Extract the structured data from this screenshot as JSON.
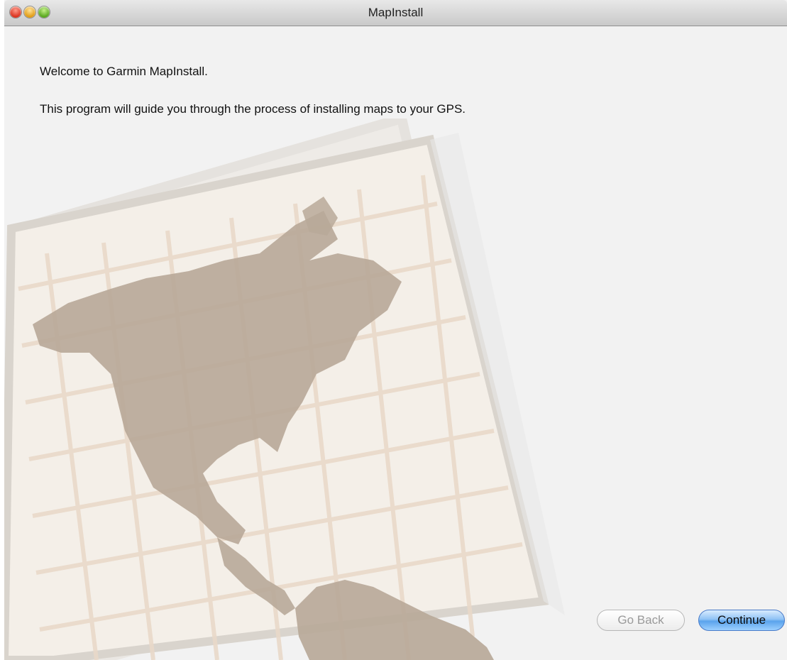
{
  "window": {
    "title": "MapInstall"
  },
  "welcome": {
    "line1": "Welcome to Garmin MapInstall.",
    "line2": "This program will guide you through the process of installing maps to your GPS."
  },
  "buttons": {
    "go_back": "Go Back",
    "continue": "Continue"
  },
  "colors": {
    "map_land": "#b8a999",
    "map_paper": "#f4efe8",
    "continue_accent": "#5aa3ec"
  },
  "icons": {
    "close": "close-icon",
    "minimize": "minimize-icon",
    "zoom": "zoom-icon",
    "illustration": "americas-map-illustration"
  }
}
